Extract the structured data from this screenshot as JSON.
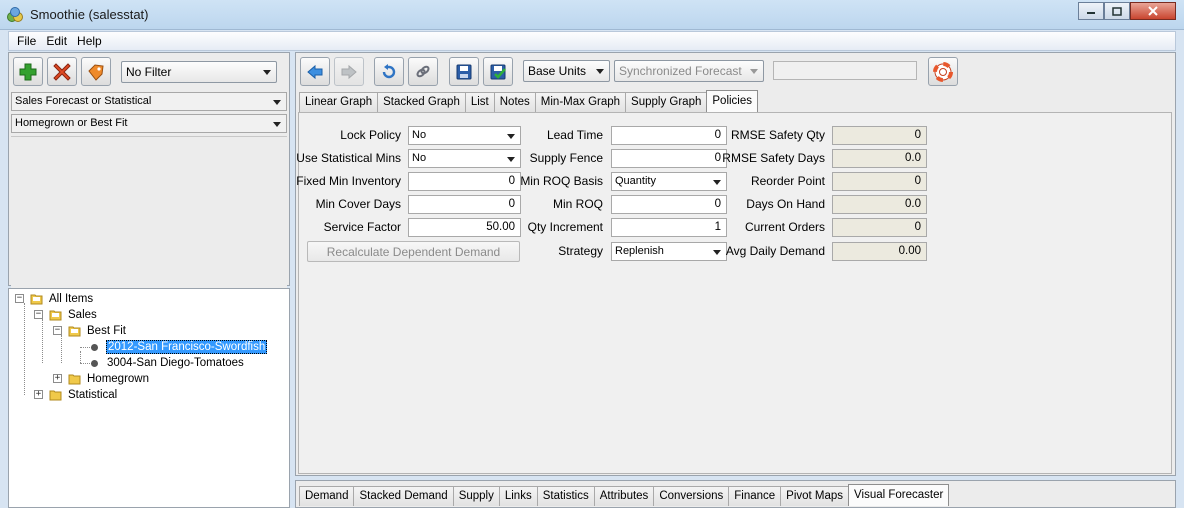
{
  "window": {
    "title": "Smoothie (salesstat)",
    "controls": [
      "minimize",
      "maximize",
      "close"
    ]
  },
  "menubar": {
    "items": [
      "File",
      "Edit",
      "Help"
    ]
  },
  "left_toolbar": {
    "buttons": [
      {
        "name": "add",
        "icon": "plus-icon",
        "color": "#2e9c2a"
      },
      {
        "name": "delete",
        "icon": "x-icon",
        "color": "#d83a1c"
      },
      {
        "name": "tag",
        "icon": "tag-icon",
        "color": "#e07a1a"
      }
    ],
    "filter": "No Filter"
  },
  "left_selectors": {
    "forecast_type": "Sales Forecast or Statistical",
    "method": "Homegrown or Best Fit"
  },
  "tree": {
    "root": "All Items",
    "sales": "Sales",
    "best_fit": "Best Fit",
    "item_1": "2012-San Francisco-Swordfish",
    "item_2": "3004-San Diego-Tomatoes",
    "homegrown": "Homegrown",
    "statistical": "Statistical"
  },
  "right_toolbar": {
    "units": "Base Units",
    "forecast_mode": "Synchronized Forecast",
    "icons": [
      "back-arrow-icon",
      "forward-arrow-icon",
      "undo-icon",
      "link-icon",
      "save-icon",
      "save-check-icon",
      "lifebuoy-icon"
    ]
  },
  "top_tabs": [
    "Linear Graph",
    "Stacked Graph",
    "List",
    "Notes",
    "Min-Max Graph",
    "Supply Graph",
    "Policies"
  ],
  "active_top_tab": "Policies",
  "policies": {
    "lock_policy": {
      "label": "Lock Policy",
      "value": "No"
    },
    "use_statistical_mins": {
      "label": "Use Statistical Mins",
      "value": "No"
    },
    "fixed_min_inventory": {
      "label": "Fixed Min Inventory",
      "value": "0"
    },
    "min_cover_days": {
      "label": "Min Cover Days",
      "value": "0"
    },
    "service_factor": {
      "label": "Service Factor",
      "value": "50.00"
    },
    "recalculate_button": "Recalculate Dependent Demand",
    "lead_time": {
      "label": "Lead Time",
      "value": "0"
    },
    "supply_fence": {
      "label": "Supply Fence",
      "value": "0"
    },
    "min_roq_basis": {
      "label": "Min ROQ Basis",
      "value": "Quantity"
    },
    "min_roq": {
      "label": "Min ROQ",
      "value": "0"
    },
    "qty_increment": {
      "label": "Qty Increment",
      "value": "1"
    },
    "strategy": {
      "label": "Strategy",
      "value": "Replenish"
    },
    "rmse_safety_qty": {
      "label": "RMSE Safety Qty",
      "value": "0"
    },
    "rmse_safety_days": {
      "label": "RMSE Safety Days",
      "value": "0.0"
    },
    "reorder_point": {
      "label": "Reorder Point",
      "value": "0"
    },
    "days_on_hand": {
      "label": "Days On Hand",
      "value": "0.0"
    },
    "current_orders": {
      "label": "Current Orders",
      "value": "0"
    },
    "avg_daily_demand": {
      "label": "Avg Daily Demand",
      "value": "0.00"
    }
  },
  "bottom_tabs": [
    "Demand",
    "Stacked Demand",
    "Supply",
    "Links",
    "Statistics",
    "Attributes",
    "Conversions",
    "Finance",
    "Pivot Maps",
    "Visual Forecaster"
  ],
  "active_bottom_tab": "Visual Forecaster"
}
